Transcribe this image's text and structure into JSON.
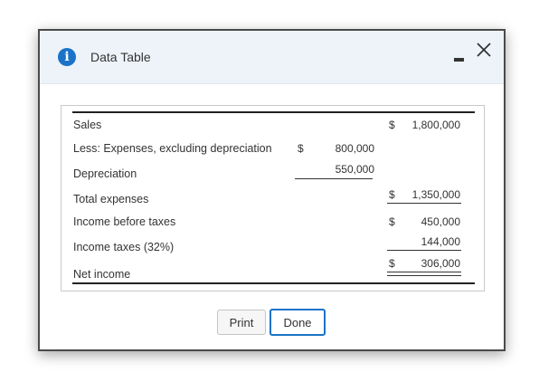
{
  "dialog": {
    "title": "Data Table",
    "icon": "info-icon",
    "controls": {
      "minimize": "minimize-icon",
      "close": "close-icon"
    }
  },
  "table": {
    "rows": [
      {
        "label": "Sales",
        "col1_dollar": "",
        "col1": "",
        "col2_dollar": "$",
        "col2": "1,800,000"
      },
      {
        "label": "Less: Expenses, excluding depreciation",
        "col1_dollar": "$",
        "col1": "800,000",
        "col2_dollar": "",
        "col2": ""
      },
      {
        "label": "Depreciation",
        "col1_dollar": "",
        "col1": "550,000",
        "col2_dollar": "",
        "col2": ""
      },
      {
        "label": "Total expenses",
        "col1_dollar": "",
        "col1": "",
        "col2_dollar": "$",
        "col2": "1,350,000"
      },
      {
        "label": "Income before taxes",
        "col1_dollar": "",
        "col1": "",
        "col2_dollar": "$",
        "col2": "450,000"
      },
      {
        "label": "Income taxes (32%)",
        "col1_dollar": "",
        "col1": "",
        "col2_dollar": "",
        "col2": "144,000"
      },
      {
        "label": "Net income",
        "col1_dollar": "",
        "col1": "",
        "col2_dollar": "$",
        "col2": "306,000"
      }
    ]
  },
  "buttons": {
    "print": "Print",
    "done": "Done"
  },
  "colors": {
    "accent": "#1a73c8",
    "titlebar": "#eef3fa",
    "border": "#4a4a4a"
  }
}
